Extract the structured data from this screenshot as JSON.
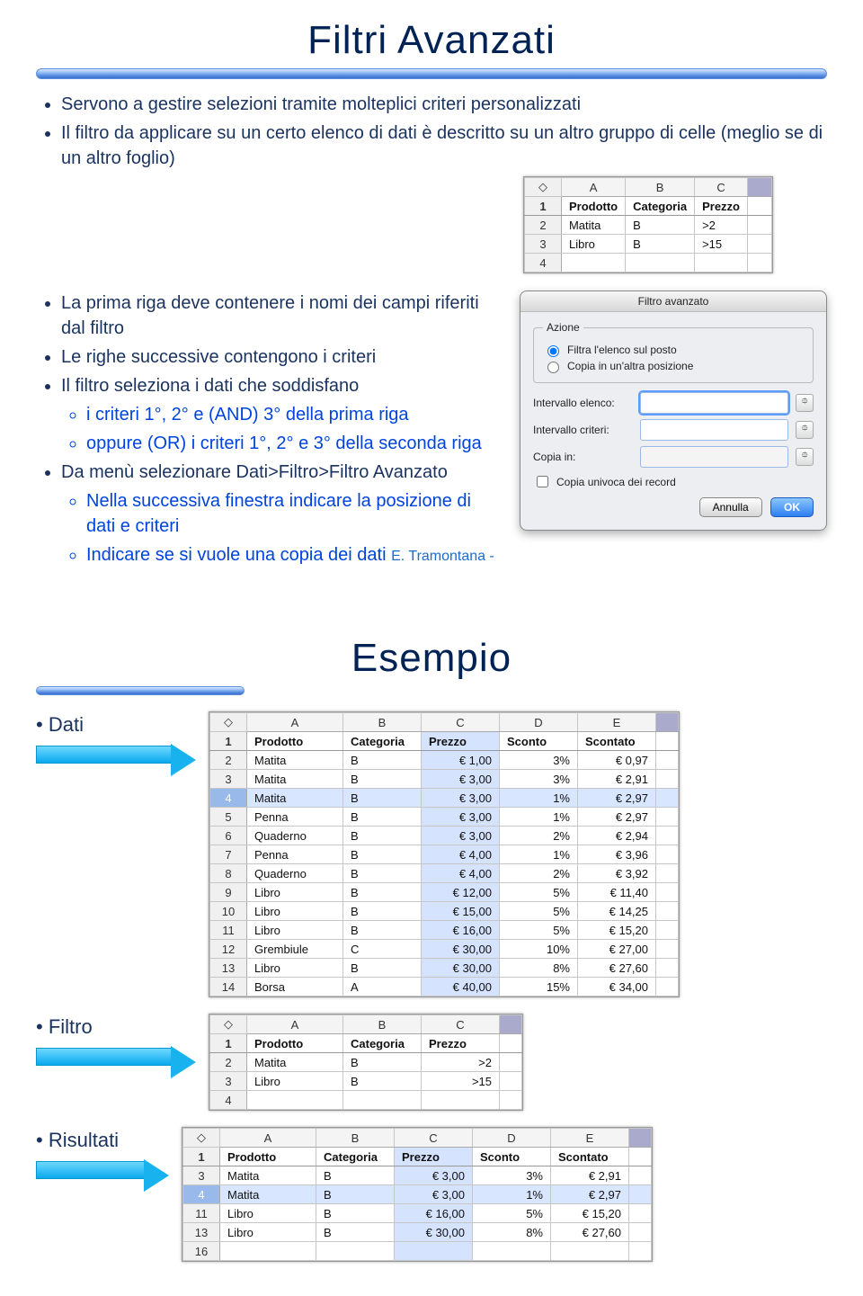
{
  "slide1": {
    "title": "Filtri Avanzati",
    "bullets_top": [
      "Servono a gestire selezioni tramite molteplici criteri personalizzati",
      "Il filtro da applicare su un certo elenco di dati è descritto su un altro gruppo di celle (meglio se di un altro foglio)"
    ],
    "mini_table": {
      "cols": [
        "A",
        "B",
        "C"
      ],
      "rows": [
        [
          "Prodotto",
          "Categoria",
          "Prezzo"
        ],
        [
          "Matita",
          "B",
          ">2"
        ],
        [
          "Libro",
          "B",
          ">15"
        ]
      ]
    },
    "bullets_mid": [
      "La prima riga deve contenere i nomi dei campi riferiti dal filtro",
      "Le righe successive contengono i criteri",
      "Il filtro seleziona i dati che soddisfano"
    ],
    "bullets_sub_blue": [
      "i criteri 1°, 2° e (AND) 3° della prima riga",
      "oppure (OR) i criteri 1°, 2° e 3° della seconda riga"
    ],
    "bullet_after_blue": "Da menù selezionare Dati>Filtro>Filtro Avanzato",
    "bullets_sub_blue2": [
      "Nella successiva finestra indicare la posizione di dati e criteri",
      "Indicare se si vuole una copia dei dati"
    ],
    "footer_note": "E. Tramontana - "
  },
  "dialog": {
    "title": "Filtro avanzato",
    "group_label": "Azione",
    "radio1": "Filtra l'elenco sul posto",
    "radio2": "Copia in un'altra posizione",
    "field1_label": "Intervallo elenco:",
    "field2_label": "Intervallo criteri:",
    "field3_label": "Copia in:",
    "checkbox": "Copia univoca dei record",
    "btn_cancel": "Annulla",
    "btn_ok": "OK"
  },
  "slide2": {
    "title": "Esempio",
    "labels": {
      "dati": "Dati",
      "filtro": "Filtro",
      "risultati": "Risultati"
    },
    "chart_data": [
      {
        "type": "table",
        "name": "Dati",
        "columns": [
          "Prodotto",
          "Categoria",
          "Prezzo",
          "Sconto",
          "Scontato"
        ],
        "col_letters": [
          "A",
          "B",
          "C",
          "D",
          "E"
        ],
        "row_numbers": [
          1,
          2,
          3,
          4,
          5,
          6,
          7,
          8,
          9,
          10,
          11,
          12,
          13,
          14
        ],
        "rows": [
          [
            "Matita",
            "B",
            "€ 1,00",
            "3%",
            "€ 0,97"
          ],
          [
            "Matita",
            "B",
            "€ 3,00",
            "3%",
            "€ 2,91"
          ],
          [
            "Matita",
            "B",
            "€ 3,00",
            "1%",
            "€ 2,97"
          ],
          [
            "Penna",
            "B",
            "€ 3,00",
            "1%",
            "€ 2,97"
          ],
          [
            "Quaderno",
            "B",
            "€ 3,00",
            "2%",
            "€ 2,94"
          ],
          [
            "Penna",
            "B",
            "€ 4,00",
            "1%",
            "€ 3,96"
          ],
          [
            "Quaderno",
            "B",
            "€ 4,00",
            "2%",
            "€ 3,92"
          ],
          [
            "Libro",
            "B",
            "€ 12,00",
            "5%",
            "€ 11,40"
          ],
          [
            "Libro",
            "B",
            "€ 15,00",
            "5%",
            "€ 14,25"
          ],
          [
            "Libro",
            "B",
            "€ 16,00",
            "5%",
            "€ 15,20"
          ],
          [
            "Grembiule",
            "C",
            "€ 30,00",
            "10%",
            "€ 27,00"
          ],
          [
            "Libro",
            "B",
            "€ 30,00",
            "8%",
            "€ 27,60"
          ],
          [
            "Borsa",
            "A",
            "€ 40,00",
            "15%",
            "€ 34,00"
          ]
        ],
        "selected_col_letter": "C",
        "selected_row_number": 4
      },
      {
        "type": "table",
        "name": "Filtro",
        "columns": [
          "Prodotto",
          "Categoria",
          "Prezzo"
        ],
        "col_letters": [
          "A",
          "B",
          "C"
        ],
        "row_numbers": [
          1,
          2,
          3,
          4
        ],
        "rows": [
          [
            "Matita",
            "B",
            ">2"
          ],
          [
            "Libro",
            "B",
            ">15"
          ]
        ]
      },
      {
        "type": "table",
        "name": "Risultati",
        "columns": [
          "Prodotto",
          "Categoria",
          "Prezzo",
          "Sconto",
          "Scontato"
        ],
        "col_letters": [
          "A",
          "B",
          "C",
          "D",
          "E"
        ],
        "row_numbers": [
          1,
          3,
          4,
          11,
          13,
          16
        ],
        "selected_col_letter": "C",
        "selected_row_number": 4,
        "rows": [
          [
            "Matita",
            "B",
            "€ 3,00",
            "3%",
            "€ 2,91"
          ],
          [
            "Matita",
            "B",
            "€ 3,00",
            "1%",
            "€ 2,97"
          ],
          [
            "Libro",
            "B",
            "€ 16,00",
            "5%",
            "€ 15,20"
          ],
          [
            "Libro",
            "B",
            "€ 30,00",
            "8%",
            "€ 27,60"
          ]
        ]
      }
    ]
  }
}
